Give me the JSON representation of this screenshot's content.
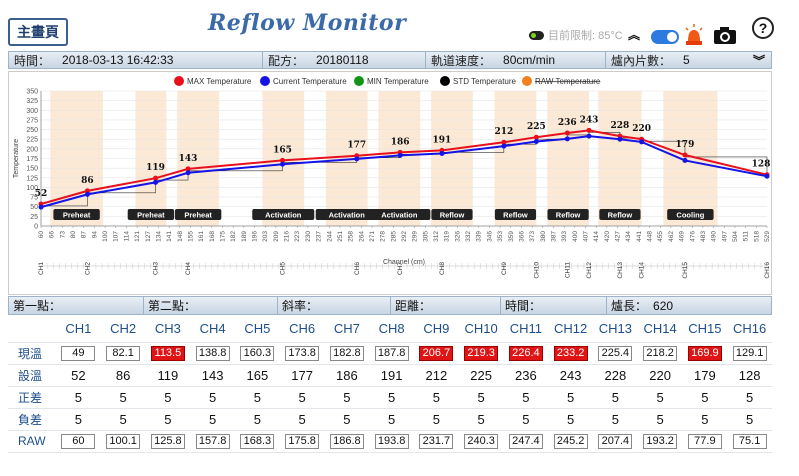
{
  "header": {
    "home_label": "主畫頁",
    "title": "Reflow Monitor",
    "temp_limit_label": "目前限制: 85°C"
  },
  "info": {
    "time_label": "時間：",
    "time_value": "2018-03-13 16:42:33",
    "recipe_label": "配方：",
    "recipe_value": "20180118",
    "speed_label": "軌道速度：",
    "speed_value": "80cm/min",
    "pieces_label": "爐內片數：",
    "pieces_value": "5"
  },
  "stats": {
    "p1_label": "第一點：",
    "p2_label": "第二點：",
    "slope_label": "斜率：",
    "dist_label": "距離：",
    "time_label": "時間：",
    "oven_len_label": "爐長：",
    "oven_len_value": "620"
  },
  "table": {
    "headers": [
      "CH1",
      "CH2",
      "CH3",
      "CH4",
      "CH5",
      "CH6",
      "CH7",
      "CH8",
      "CH9",
      "CH10",
      "CH11",
      "CH12",
      "CH13",
      "CH14",
      "CH15",
      "CH16"
    ],
    "rows": [
      {
        "label": "現溫",
        "type": "box",
        "values": [
          "49",
          "82.1",
          "113.5",
          "138.8",
          "160.3",
          "173.8",
          "182.8",
          "187.8",
          "206.7",
          "219.3",
          "226.4",
          "233.2",
          "225.4",
          "218.2",
          "169.9",
          "129.1"
        ],
        "hot": [
          false,
          false,
          true,
          false,
          false,
          false,
          false,
          false,
          true,
          true,
          true,
          true,
          false,
          false,
          true,
          false
        ]
      },
      {
        "label": "設溫",
        "type": "num",
        "values": [
          "52",
          "86",
          "119",
          "143",
          "165",
          "177",
          "186",
          "191",
          "212",
          "225",
          "236",
          "243",
          "228",
          "220",
          "179",
          "128"
        ]
      },
      {
        "label": "正差",
        "type": "num",
        "values": [
          "5",
          "5",
          "5",
          "5",
          "5",
          "5",
          "5",
          "5",
          "5",
          "5",
          "5",
          "5",
          "5",
          "5",
          "5",
          "5"
        ]
      },
      {
        "label": "負差",
        "type": "num",
        "values": [
          "5",
          "5",
          "5",
          "5",
          "5",
          "5",
          "5",
          "5",
          "5",
          "5",
          "5",
          "5",
          "5",
          "5",
          "5",
          "5"
        ]
      },
      {
        "label": "RAW",
        "type": "box",
        "values": [
          "60",
          "100.1",
          "125.8",
          "157.8",
          "168.3",
          "175.8",
          "186.8",
          "193.8",
          "231.7",
          "240.3",
          "247.4",
          "245.2",
          "207.4",
          "193.2",
          "77.9",
          "75.1"
        ],
        "hot": [
          false,
          false,
          false,
          false,
          false,
          false,
          false,
          false,
          false,
          false,
          false,
          false,
          false,
          false,
          false,
          false
        ]
      }
    ]
  },
  "chart_data": {
    "type": "line",
    "ylabel": "Temperature",
    "xlabel": "Channel (cm)",
    "ylim": [
      0,
      350
    ],
    "xlim": [
      60,
      529
    ],
    "yticks": [
      0,
      25,
      50,
      75,
      100,
      125,
      150,
      175,
      200,
      225,
      250,
      275,
      300,
      325,
      350
    ],
    "xticks": [
      "60",
      "66",
      "73",
      "80",
      "87",
      "94",
      "100",
      "107",
      "114",
      "121",
      "127",
      "134",
      "141",
      "148",
      "155",
      "161",
      "168",
      "175",
      "182",
      "189",
      "196",
      "203",
      "209",
      "216",
      "223",
      "230",
      "237",
      "244",
      "251",
      "258",
      "264",
      "271",
      "278",
      "285",
      "292",
      "299",
      "305",
      "312",
      "319",
      "326",
      "332",
      "339",
      "346",
      "353",
      "359",
      "366",
      "373",
      "380",
      "387",
      "393",
      "400",
      "407",
      "414",
      "420",
      "427",
      "434",
      "441",
      "448",
      "455",
      "462",
      "469",
      "476",
      "483",
      "490",
      "497",
      "504",
      "511",
      "518",
      "529"
    ],
    "legend": [
      "MAX Temperature",
      "Current Temperature",
      "MIN Temperature",
      "STD Temperature",
      "RAW Temperature"
    ],
    "legend_colors": [
      "#e8101c",
      "#1414e6",
      "#149414",
      "#000000",
      "#f08020"
    ],
    "channels": [
      {
        "name": "CH1",
        "x": 60,
        "set": 52
      },
      {
        "name": "CH2",
        "x": 90,
        "set": 86
      },
      {
        "name": "CH3",
        "x": 134,
        "set": 119
      },
      {
        "name": "CH4",
        "x": 155,
        "set": 143
      },
      {
        "name": "CH5",
        "x": 216,
        "set": 165
      },
      {
        "name": "CH6",
        "x": 264,
        "set": 177
      },
      {
        "name": "CH7",
        "x": 292,
        "set": 186
      },
      {
        "name": "CH8",
        "x": 319,
        "set": 191
      },
      {
        "name": "CH9",
        "x": 359,
        "set": 212
      },
      {
        "name": "CH10",
        "x": 380,
        "set": 225
      },
      {
        "name": "CH11",
        "x": 400,
        "set": 236
      },
      {
        "name": "CH12",
        "x": 414,
        "set": 243
      },
      {
        "name": "CH13",
        "x": 434,
        "set": 228
      },
      {
        "name": "CH14",
        "x": 448,
        "set": 220
      },
      {
        "name": "CH15",
        "x": 476,
        "set": 179
      },
      {
        "name": "CH16",
        "x": 529,
        "set": 128
      }
    ],
    "series": [
      {
        "name": "MAX Temperature",
        "color": "#e8101c",
        "points": [
          [
            60,
            57
          ],
          [
            90,
            91
          ],
          [
            134,
            124
          ],
          [
            155,
            148
          ],
          [
            216,
            170
          ],
          [
            264,
            182
          ],
          [
            292,
            191
          ],
          [
            319,
            196
          ],
          [
            359,
            217
          ],
          [
            380,
            230
          ],
          [
            400,
            241
          ],
          [
            414,
            248
          ],
          [
            434,
            233
          ],
          [
            448,
            225
          ],
          [
            476,
            184
          ],
          [
            529,
            133
          ]
        ]
      },
      {
        "name": "Current Temperature",
        "color": "#1414e6",
        "points": [
          [
            60,
            49
          ],
          [
            90,
            82
          ],
          [
            134,
            113
          ],
          [
            155,
            138
          ],
          [
            216,
            160
          ],
          [
            264,
            174
          ],
          [
            292,
            183
          ],
          [
            319,
            188
          ],
          [
            359,
            207
          ],
          [
            380,
            219
          ],
          [
            400,
            226
          ],
          [
            414,
            233
          ],
          [
            434,
            225
          ],
          [
            448,
            218
          ],
          [
            476,
            170
          ],
          [
            529,
            129
          ]
        ]
      }
    ],
    "zones": [
      {
        "label": "Preheat",
        "x0": 66,
        "x1": 100
      },
      {
        "label": "Preheat",
        "x0": 121,
        "x1": 141
      },
      {
        "label": "Preheat",
        "x0": 148,
        "x1": 175
      },
      {
        "label": "Activation",
        "x0": 203,
        "x1": 230
      },
      {
        "label": "Activation",
        "x0": 244,
        "x1": 271
      },
      {
        "label": "Activation",
        "x0": 278,
        "x1": 305
      },
      {
        "label": "Reflow",
        "x0": 312,
        "x1": 339
      },
      {
        "label": "Reflow",
        "x0": 353,
        "x1": 380
      },
      {
        "label": "Reflow",
        "x0": 387,
        "x1": 414
      },
      {
        "label": "Reflow",
        "x0": 420,
        "x1": 448
      },
      {
        "label": "Cooling",
        "x0": 462,
        "x1": 497
      }
    ]
  }
}
